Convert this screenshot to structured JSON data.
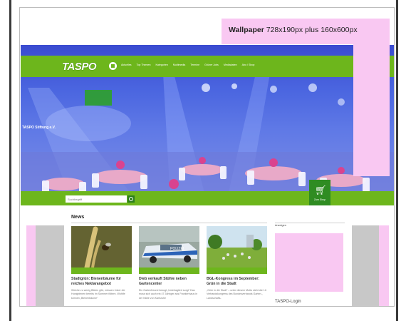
{
  "ads": {
    "wallpaper_bold": "Wallpaper",
    "wallpaper_size": " 728x190px plus 160x600px"
  },
  "brand": {
    "logo": "TASPO",
    "banner_text": "TASPO Stiftung e.V."
  },
  "nav": {
    "items": [
      "Aktuelles",
      "Top Themen",
      "Kategorien",
      "Multimedia",
      "Termine",
      "Grüner Jobs",
      "Mediadaten",
      "Abo / Shop"
    ]
  },
  "search": {
    "placeholder": "Suchbegriff"
  },
  "cart": {
    "label": "Zum Shop"
  },
  "news": {
    "title": "News",
    "articles": [
      {
        "headline": "Stadtgrün: Bienenbäume für reiches Nektarangebot",
        "teaser": "Welche zu wenig Blüten gibt, müssen Imker die Honigbienen bereits im Sommer füttern. Wohlfe können „Bienenbäume“"
      },
      {
        "headline": "Dieb verkauft Stühle neben Gartencenter",
        "teaser": "Ein Gartenfreund bezugt „Unterlagtiert sorgt“ Das muss sich auch ein 47 Jähriger aus Frankenhaus in der Nähe von Karlsruhe"
      },
      {
        "headline": "BGL-Kongress im September: Grün in die Stadt",
        "teaser": "„Grün in die Stadt“ – unter diesem Motto steht die 12. Verbandskongress des Bundesverbands Garten-, Landschafts-"
      }
    ]
  },
  "sidebar": {
    "heading": "Anzeigen",
    "login": "TASPO-Login"
  },
  "colors": {
    "green": "#6db61c",
    "dark_green": "#2f8c22",
    "ad_pink": "#f9c8f2"
  }
}
